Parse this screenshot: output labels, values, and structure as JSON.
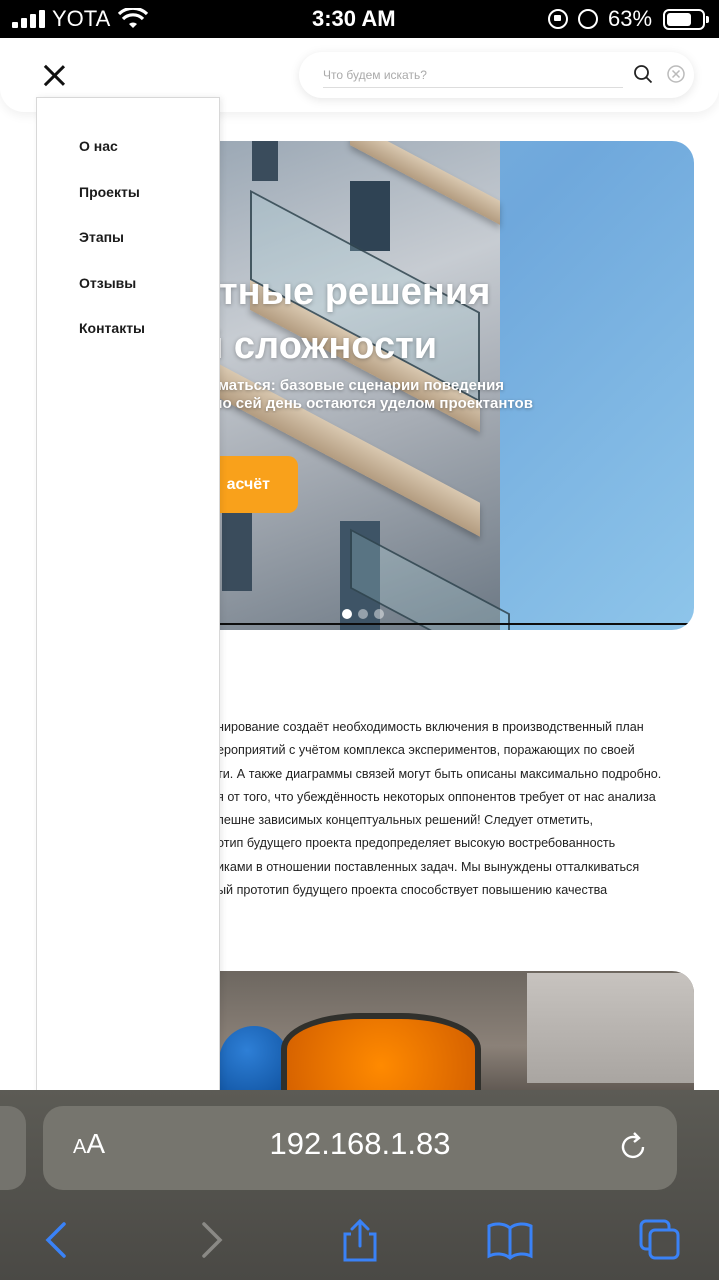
{
  "status_bar": {
    "carrier": "YOTA",
    "time": "3:30 AM",
    "battery_percent": "63%",
    "icons": [
      "signal-icon",
      "wifi-icon",
      "orientation-lock-icon",
      "alarm-icon",
      "battery-icon"
    ]
  },
  "header": {
    "search_placeholder": "Что будем искать?",
    "icons": [
      "close-icon",
      "search-icon",
      "clear-icon"
    ]
  },
  "menu": {
    "items": [
      "О нас",
      "Проекты",
      "Этапы",
      "Отзывы",
      "Контакты"
    ]
  },
  "hero": {
    "title_line1": "ктные решения",
    "title_line2": "й сложности",
    "subtitle_line1": "думаться: базовые сценарии поведения",
    "subtitle_line2": "и по сей день остаются уделом проектантов",
    "button_label": "асчёт",
    "accent_color": "#f9a11b"
  },
  "article": {
    "lines": [
      "нирование создаёт необходимость включения в производственный план",
      "ероприятий с учётом комплекса экспериментов, поражающих по своей",
      "ти. А также диаграммы связей могут быть описаны максимально подробно.",
      "я от того, что убеждённость некоторых оппонентов требует от нас анализа",
      "пешне зависимых концептуальных решений! Следует отметить,",
      "отип будущего проекта предопределяет высокую востребованность",
      "иками в отношении поставленных задач. Мы вынуждены отталкиваться",
      "ый прототип будущего проекта способствует повышению качества"
    ]
  },
  "safari": {
    "text_size_button_small": "A",
    "text_size_button_large": "A",
    "url": "192.168.1.83",
    "toolbar": [
      "back-icon",
      "forward-icon",
      "share-icon",
      "bookmarks-icon",
      "tabs-icon"
    ],
    "accent_color": "#3a82f7"
  }
}
